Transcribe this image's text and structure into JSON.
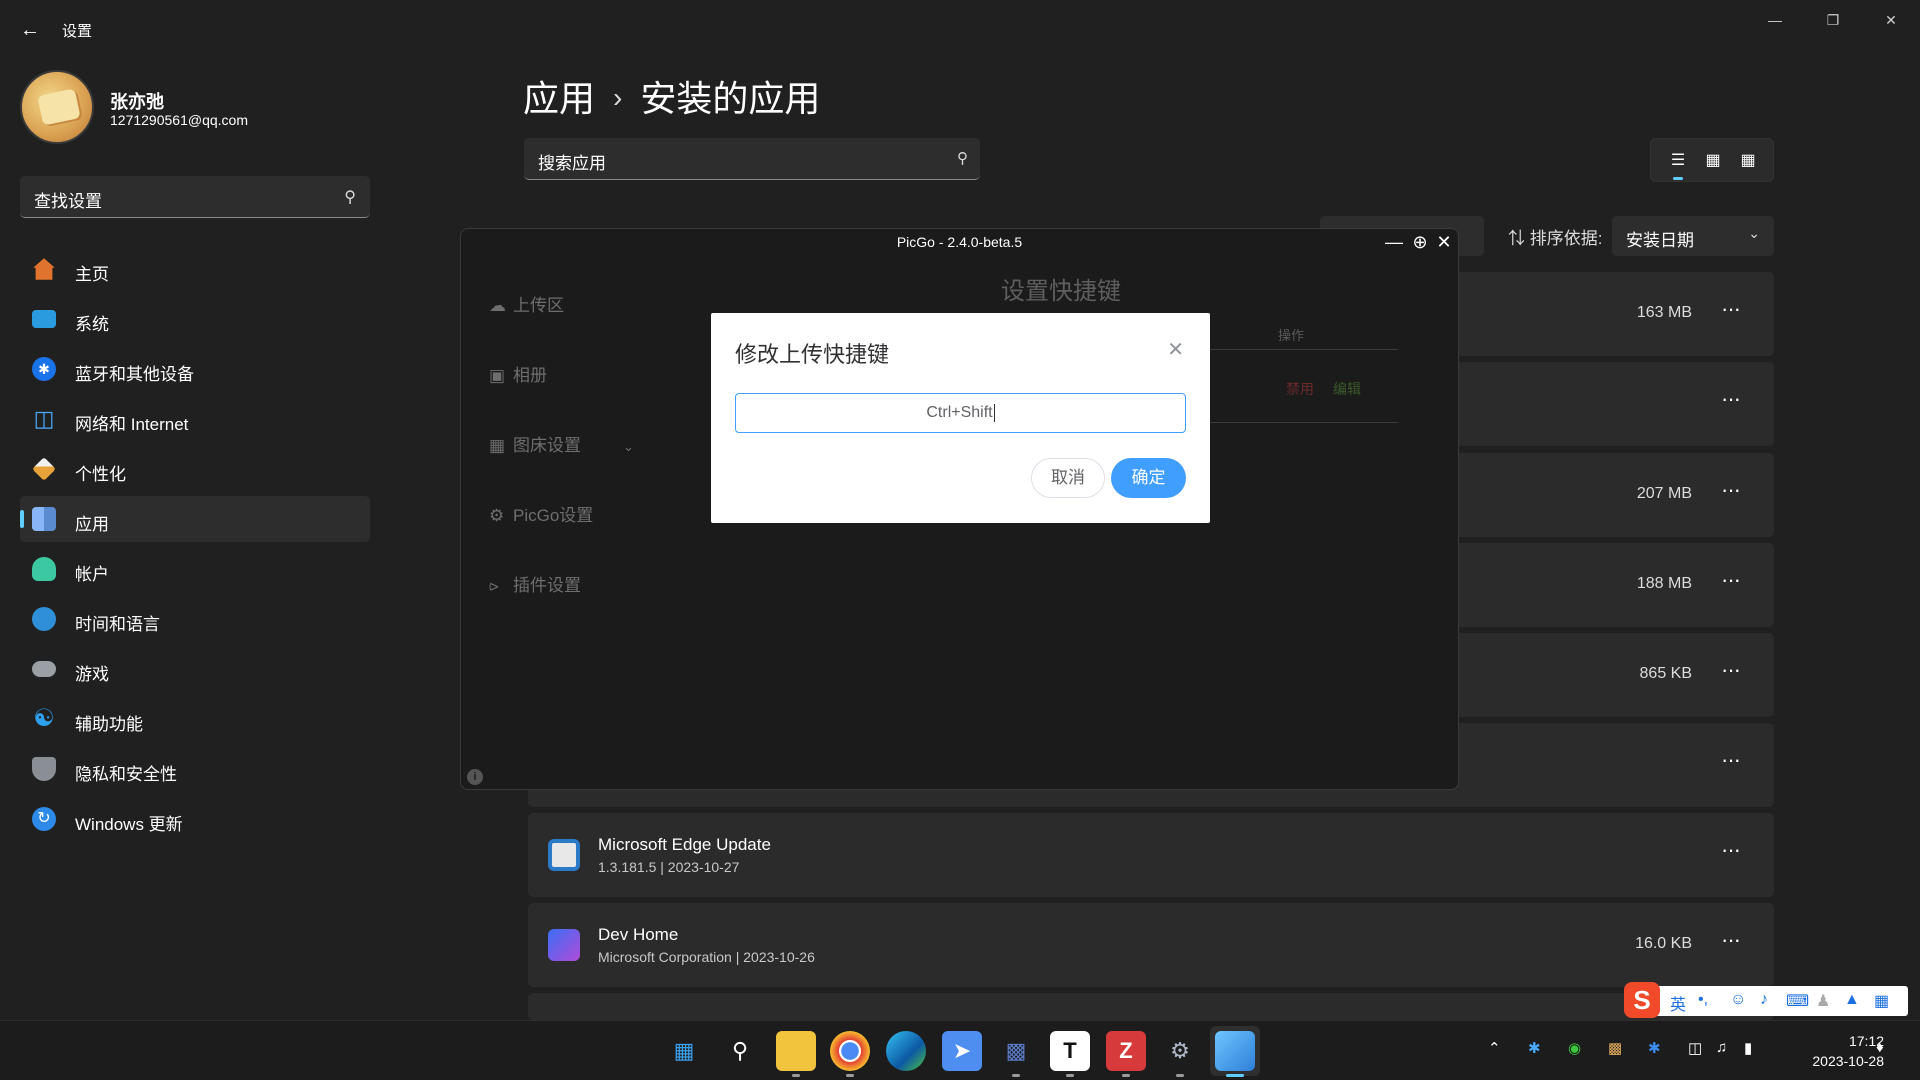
{
  "window": {
    "title": "设置"
  },
  "profile": {
    "name": "张亦弛",
    "email": "1271290561@qq.com"
  },
  "find_settings": {
    "placeholder": "查找设置"
  },
  "nav": [
    {
      "label": "主页",
      "icon": "home-icon",
      "color": "#e0742e"
    },
    {
      "label": "系统",
      "icon": "system-icon",
      "color": "#2b9be0"
    },
    {
      "label": "蓝牙和其他设备",
      "icon": "bluetooth-icon",
      "color": "#1a73e8"
    },
    {
      "label": "网络和 Internet",
      "icon": "wifi-icon",
      "color": "#4aa8ff"
    },
    {
      "label": "个性化",
      "icon": "brush-icon",
      "color": "#e8a23a"
    },
    {
      "label": "应用",
      "icon": "apps-icon",
      "color": "#8ab4f8",
      "active": true
    },
    {
      "label": "帐户",
      "icon": "account-icon",
      "color": "#3cc8a0"
    },
    {
      "label": "时间和语言",
      "icon": "clock-globe-icon",
      "color": "#2f8fd8"
    },
    {
      "label": "游戏",
      "icon": "gamepad-icon",
      "color": "#9aa0a6"
    },
    {
      "label": "辅助功能",
      "icon": "accessibility-icon",
      "color": "#2f9ff0"
    },
    {
      "label": "隐私和安全性",
      "icon": "shield-icon",
      "color": "#8a8f96"
    },
    {
      "label": "Windows 更新",
      "icon": "update-icon",
      "color": "#2d8ae8"
    }
  ],
  "breadcrumb": {
    "parent": "应用",
    "current": "安装的应用"
  },
  "search_apps": {
    "placeholder": "搜索应用"
  },
  "sort": {
    "label": "排序依据:",
    "value": "安装日期"
  },
  "apps": [
    {
      "name": "",
      "meta": "",
      "size": "163 MB"
    },
    {
      "name": "",
      "meta": "",
      "size": ""
    },
    {
      "name": "",
      "meta": "",
      "size": "207 MB"
    },
    {
      "name": "",
      "meta": "",
      "size": "188 MB"
    },
    {
      "name": "",
      "meta": "",
      "size": "865 KB"
    },
    {
      "name": "",
      "meta": "",
      "size": ""
    },
    {
      "name": "Microsoft Edge Update",
      "meta": "1.3.181.5 | 2023-10-27",
      "size": "",
      "icon": "edge-update-icon"
    },
    {
      "name": "Dev Home",
      "meta": "Microsoft Corporation | 2023-10-26",
      "size": "16.0 KB",
      "icon": "dev-home-icon"
    }
  ],
  "picgo": {
    "title": "PicGo - 2.4.0-beta.5",
    "sidebar": [
      {
        "label": "上传区",
        "icon": "cloud-upload-icon"
      },
      {
        "label": "相册",
        "icon": "image-icon"
      },
      {
        "label": "图床设置",
        "icon": "grid-icon"
      },
      {
        "label": "PicGo设置",
        "icon": "gear-icon"
      },
      {
        "label": "插件设置",
        "icon": "share-icon"
      }
    ],
    "page_title": "设置快捷键",
    "column_action": "操作",
    "action_disable": "禁用",
    "action_edit": "编辑",
    "dialog": {
      "title": "修改上传快捷键",
      "input_value": "Ctrl+Shift",
      "cancel": "取消",
      "confirm": "确定"
    }
  },
  "ime": {
    "mode": "英",
    "punct": "•,"
  },
  "taskbar": {
    "time": "17:12",
    "date": "2023-10-28"
  },
  "colors": {
    "accent": "#60cdff",
    "picgo_primary": "#409eff"
  }
}
